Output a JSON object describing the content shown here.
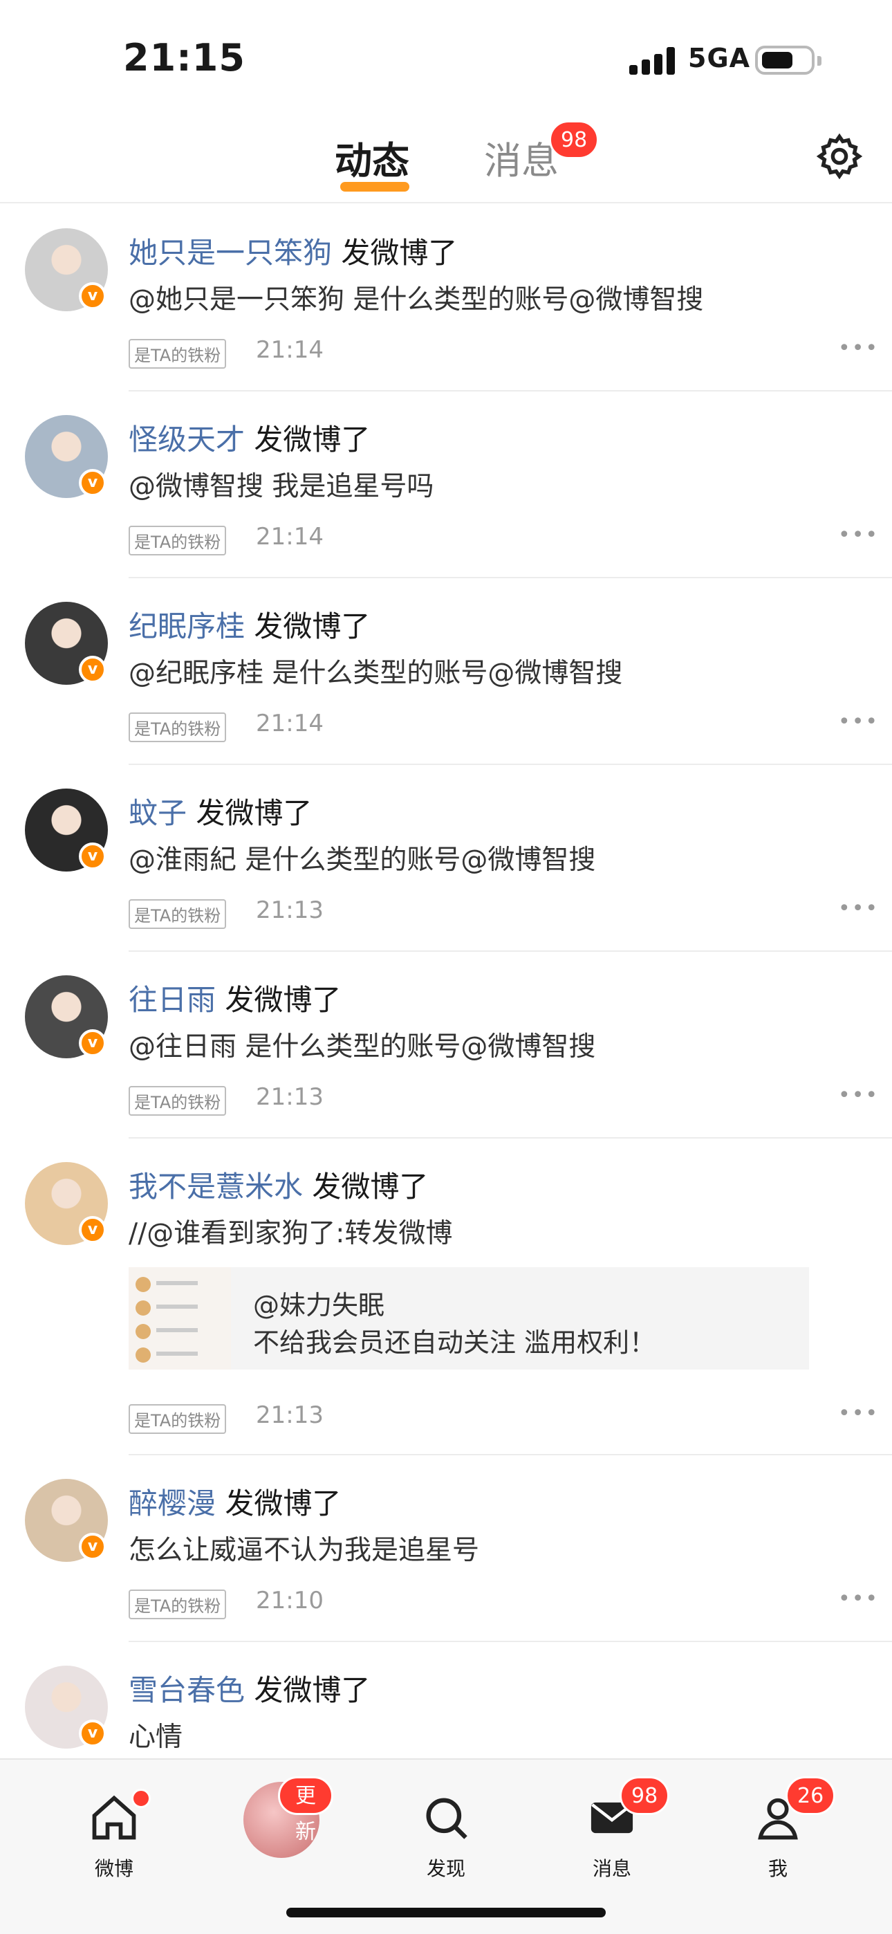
{
  "status_bar": {
    "time": "21:15",
    "network": "5GA",
    "battery_level": 0.55
  },
  "top_tabs": {
    "active": "动态",
    "inactive": "消息",
    "badge": "98",
    "settings_icon": "gear-icon"
  },
  "feed": [
    {
      "name": "她只是一只笨狗",
      "action": "发微博了",
      "text": "@她只是一只笨狗 是什么类型的账号@微博智搜",
      "fan_tag": "是TA的铁粉",
      "time": "21:14",
      "avatar_color": "#cfcfcf"
    },
    {
      "name": "怪级天才",
      "action": "发微博了",
      "text": "@微博智搜 我是追星号吗",
      "fan_tag": "是TA的铁粉",
      "time": "21:14",
      "avatar_color": "#a9b8c8"
    },
    {
      "name": "纪眠序桂",
      "action": "发微博了",
      "text": "@纪眠序桂 是什么类型的账号@微博智搜",
      "fan_tag": "是TA的铁粉",
      "time": "21:14",
      "avatar_color": "#3a3a3a"
    },
    {
      "name": "蚊子",
      "action": "发微博了",
      "text": "@淮雨紀  是什么类型的账号@微博智搜",
      "fan_tag": "是TA的铁粉",
      "time": "21:13",
      "avatar_color": "#2a2a2a"
    },
    {
      "name": "往日雨",
      "action": "发微博了",
      "text": "@往日雨 是什么类型的账号@微博智搜",
      "fan_tag": "是TA的铁粉",
      "time": "21:13",
      "avatar_color": "#4a4a4a"
    },
    {
      "name": "我不是薏米水",
      "action": "发微博了",
      "text": "//@谁看到家狗了:转发微博",
      "fan_tag": "是TA的铁粉",
      "time": "21:13",
      "avatar_color": "#e8c9a0",
      "quote": {
        "author": "@妹力失眠",
        "text": "不给我会员还自动关注 滥用权利！"
      }
    },
    {
      "name": "醉樱漫",
      "action": "发微博了",
      "text": "怎么让威逼不认为我是追星号",
      "fan_tag": "是TA的铁粉",
      "time": "21:10",
      "avatar_color": "#d9c3a8"
    },
    {
      "name": "雪台春色",
      "action": "发微博了",
      "text": "心情",
      "fan_tag": "",
      "time": "",
      "avatar_color": "#e9e1e1"
    }
  ],
  "bottom_nav": [
    {
      "label": "微博",
      "icon": "home-icon",
      "badge": "",
      "dot": true
    },
    {
      "label": "",
      "icon": "avatar-icon",
      "badge": "更新",
      "dot": false
    },
    {
      "label": "发现",
      "icon": "search-icon",
      "badge": "",
      "dot": false
    },
    {
      "label": "消息",
      "icon": "mail-icon",
      "badge": "98",
      "dot": false
    },
    {
      "label": "我",
      "icon": "profile-icon",
      "badge": "26",
      "dot": false
    }
  ],
  "colors": {
    "accent": "#ff9a1f",
    "badge": "#ff3b30",
    "username": "#4a6fa8",
    "verified": "#ff8a00"
  }
}
